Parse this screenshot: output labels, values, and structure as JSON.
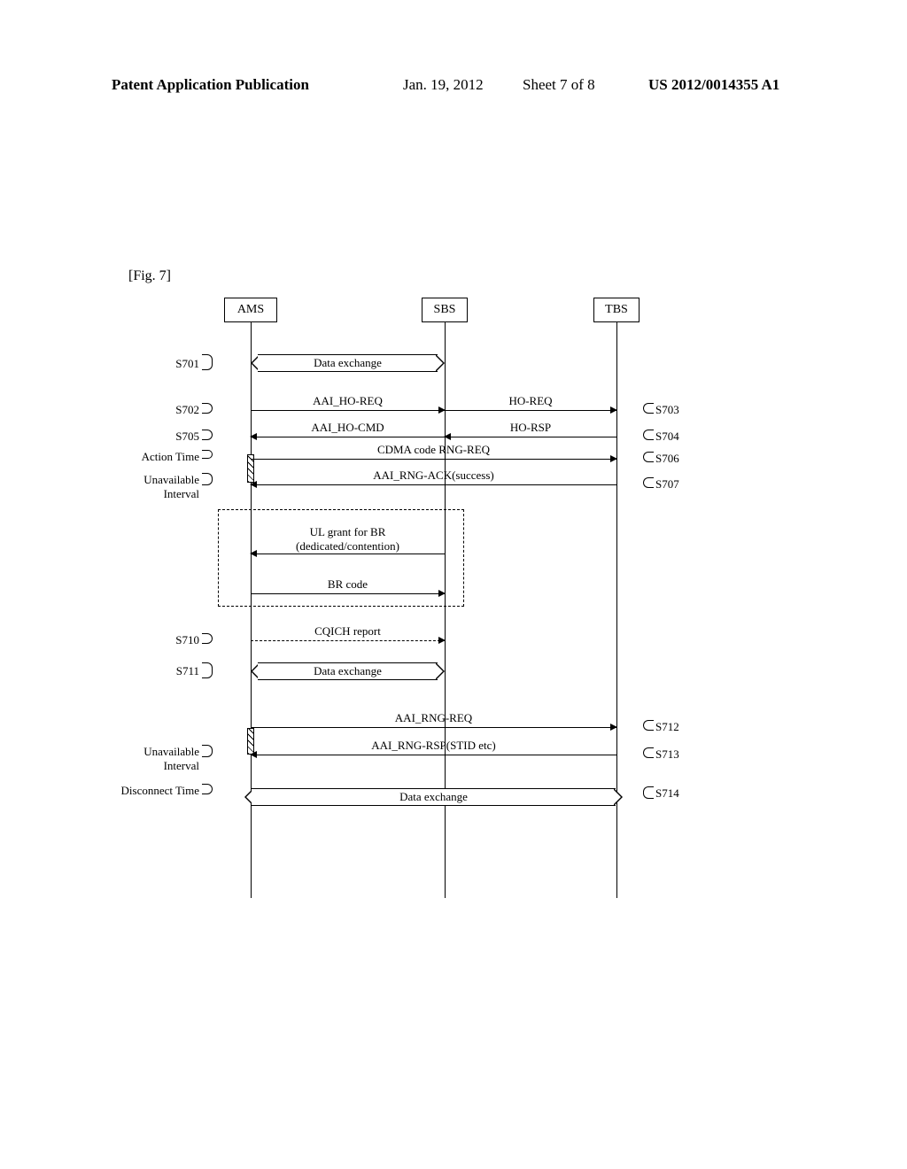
{
  "header": {
    "publication": "Patent Application Publication",
    "date": "Jan. 19, 2012",
    "sheet": "Sheet 7 of 8",
    "number": "US 2012/0014355 A1"
  },
  "figure_label": "[Fig. 7]",
  "actors": {
    "ams": "AMS",
    "sbs": "SBS",
    "tbs": "TBS"
  },
  "steps_left": {
    "s701": "S701",
    "s702": "S702",
    "s705": "S705",
    "action_time": "Action Time",
    "unavailable_interval_1": "Unavailable\nInterval",
    "s710": "S710",
    "s711": "S711",
    "unavailable_interval_2": "Unavailable\nInterval",
    "disconnect_time": "Disconnect Time"
  },
  "steps_right": {
    "s703": "S703",
    "s704": "S704",
    "s706": "S706",
    "s707": "S707",
    "s712": "S712",
    "s713": "S713",
    "s714": "S714"
  },
  "messages": {
    "data_exchange_1": "Data exchange",
    "aai_ho_req": "AAI_HO-REQ",
    "ho_req": "HO-REQ",
    "aai_ho_cmd": "AAI_HO-CMD",
    "ho_rsp": "HO-RSP",
    "cdma_rng_req": "CDMA code RNG-REQ",
    "aai_rng_ack": "AAI_RNG-ACK(success)",
    "ul_grant": "UL grant for BR\n(dedicated/contention)",
    "br_code": "BR code",
    "cqich_report": "CQICH report",
    "data_exchange_2": "Data exchange",
    "aai_rng_req": "AAI_RNG-REQ",
    "aai_rng_rsp": "AAI_RNG-RSP(STID etc)",
    "data_exchange_3": "Data exchange"
  },
  "chart_data": {
    "type": "sequence-diagram",
    "actors": [
      "AMS",
      "SBS",
      "TBS"
    ],
    "events": [
      {
        "step": "S701",
        "type": "bidir",
        "from": "AMS",
        "to": "SBS",
        "label": "Data exchange"
      },
      {
        "step": "S702",
        "type": "msg",
        "from": "AMS",
        "to": "SBS",
        "label": "AAI_HO-REQ"
      },
      {
        "step": "S703",
        "type": "msg",
        "from": "SBS",
        "to": "TBS",
        "label": "HO-REQ"
      },
      {
        "step": "S704",
        "type": "msg",
        "from": "TBS",
        "to": "SBS",
        "label": "HO-RSP"
      },
      {
        "step": "S705",
        "type": "msg",
        "from": "SBS",
        "to": "AMS",
        "label": "AAI_HO-CMD"
      },
      {
        "marker": "Action Time",
        "on": "AMS"
      },
      {
        "step": "S706",
        "type": "msg",
        "from": "AMS",
        "to": "TBS",
        "label": "CDMA code RNG-REQ"
      },
      {
        "marker": "Unavailable Interval",
        "on": "AMS"
      },
      {
        "step": "S707",
        "type": "msg",
        "from": "TBS",
        "to": "AMS",
        "label": "AAI_RNG-ACK(success)"
      },
      {
        "type": "optional",
        "contents": [
          {
            "type": "msg",
            "from": "SBS",
            "to": "AMS",
            "label": "UL grant for BR (dedicated/contention)"
          },
          {
            "type": "msg",
            "from": "AMS",
            "to": "SBS",
            "label": "BR code"
          }
        ]
      },
      {
        "step": "S710",
        "type": "msg",
        "from": "AMS",
        "to": "SBS",
        "style": "dashed",
        "label": "CQICH report"
      },
      {
        "step": "S711",
        "type": "bidir",
        "from": "AMS",
        "to": "SBS",
        "label": "Data exchange"
      },
      {
        "step": "S712",
        "type": "msg",
        "from": "AMS",
        "to": "TBS",
        "label": "AAI_RNG-REQ"
      },
      {
        "marker": "Unavailable Interval",
        "on": "AMS"
      },
      {
        "step": "S713",
        "type": "msg",
        "from": "TBS",
        "to": "AMS",
        "label": "AAI_RNG-RSP(STID etc)"
      },
      {
        "marker": "Disconnect Time",
        "on": "AMS"
      },
      {
        "step": "S714",
        "type": "bidir",
        "from": "AMS",
        "to": "TBS",
        "label": "Data exchange"
      }
    ]
  }
}
